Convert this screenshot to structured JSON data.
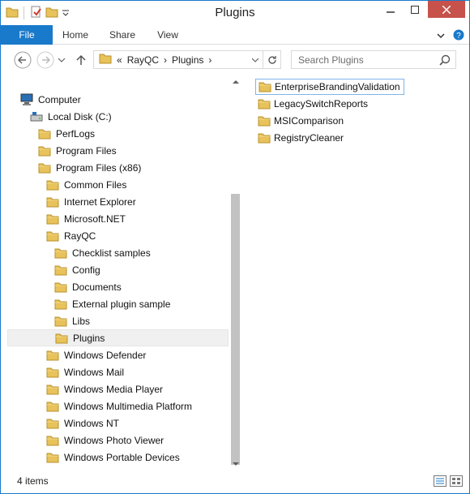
{
  "window": {
    "title": "Plugins"
  },
  "ribbon": {
    "tabs": [
      {
        "label": "File"
      },
      {
        "label": "Home"
      },
      {
        "label": "Share"
      },
      {
        "label": "View"
      }
    ]
  },
  "address": {
    "crumbs": [
      "«",
      "RayQC",
      "Plugins"
    ],
    "search_placeholder": "Search Plugins"
  },
  "tree": [
    {
      "label": "Computer",
      "icon": "computer-icon"
    },
    {
      "label": "Local Disk (C:)",
      "icon": "drive-icon"
    },
    {
      "label": "PerfLogs",
      "icon": "folder-icon"
    },
    {
      "label": "Program Files",
      "icon": "folder-icon"
    },
    {
      "label": "Program Files (x86)",
      "icon": "folder-icon"
    },
    {
      "label": "Common Files",
      "icon": "folder-icon"
    },
    {
      "label": "Internet Explorer",
      "icon": "folder-icon"
    },
    {
      "label": "Microsoft.NET",
      "icon": "folder-icon"
    },
    {
      "label": "RayQC",
      "icon": "folder-icon"
    },
    {
      "label": "Checklist samples",
      "icon": "folder-icon"
    },
    {
      "label": "Config",
      "icon": "folder-icon"
    },
    {
      "label": "Documents",
      "icon": "folder-icon"
    },
    {
      "label": "External plugin sample",
      "icon": "folder-icon"
    },
    {
      "label": "Libs",
      "icon": "folder-icon"
    },
    {
      "label": "Plugins",
      "icon": "folder-icon",
      "selected": true
    },
    {
      "label": "Windows Defender",
      "icon": "folder-icon"
    },
    {
      "label": "Windows Mail",
      "icon": "folder-icon"
    },
    {
      "label": "Windows Media Player",
      "icon": "folder-icon"
    },
    {
      "label": "Windows Multimedia Platform",
      "icon": "folder-icon"
    },
    {
      "label": "Windows NT",
      "icon": "folder-icon"
    },
    {
      "label": "Windows Photo Viewer",
      "icon": "folder-icon"
    },
    {
      "label": "Windows Portable Devices",
      "icon": "folder-icon"
    }
  ],
  "files": [
    {
      "label": "EnterpriseBrandingValidation",
      "focused": true
    },
    {
      "label": "LegacySwitchReports"
    },
    {
      "label": "MSIComparison"
    },
    {
      "label": "RegistryCleaner"
    }
  ],
  "status": {
    "count": "4 items"
  },
  "colors": {
    "accent": "#1979ca",
    "close": "#c7514b",
    "folder": "#e8c25a"
  }
}
